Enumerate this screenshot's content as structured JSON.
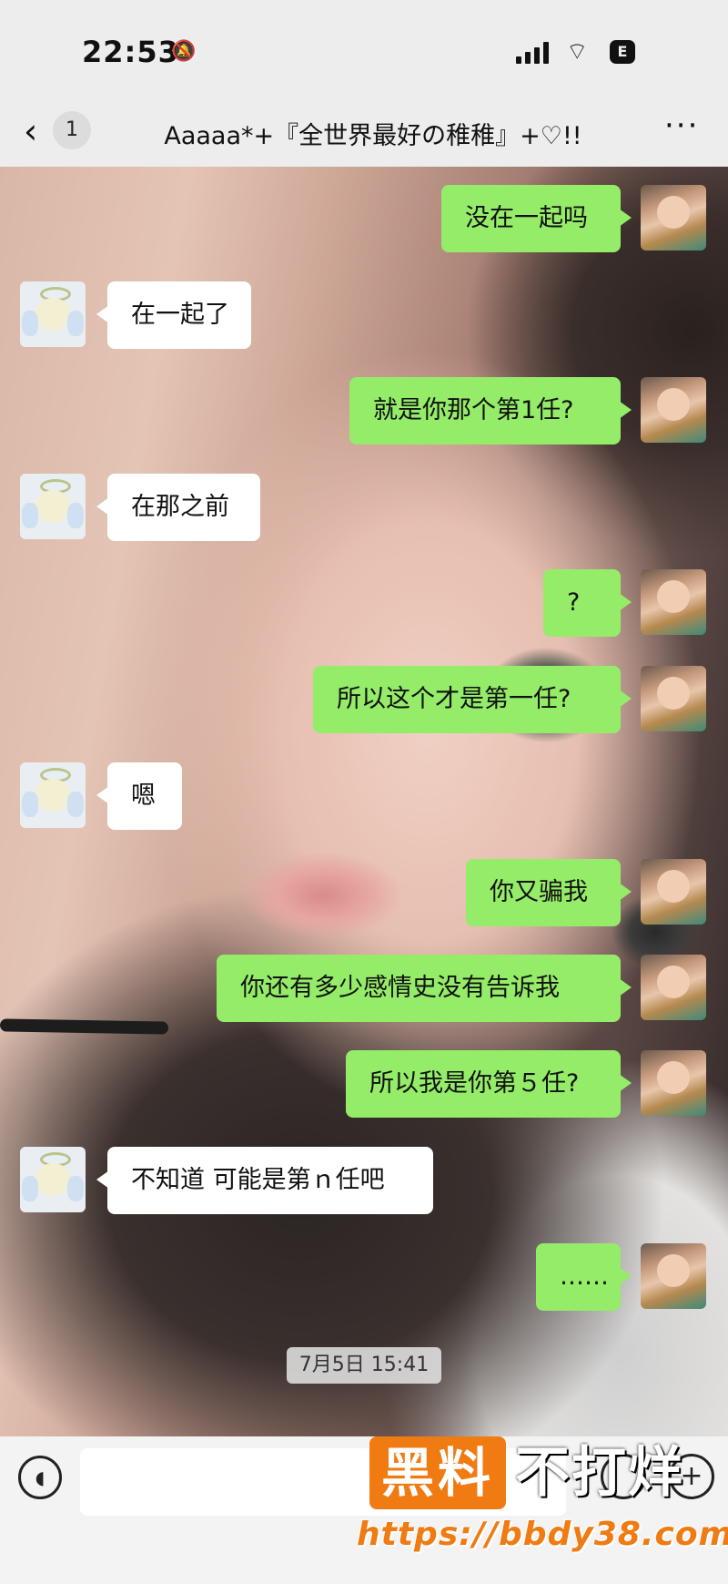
{
  "status_bar": {
    "time": "22:53",
    "battery_label": "E"
  },
  "nav": {
    "unread_count": "1",
    "chat_title": "Aaaaa*+『全世界最好の稚稚』+♡!!",
    "icons": [
      "chevron-left-icon",
      "more-icon"
    ]
  },
  "messages": [
    {
      "side": "right",
      "text": "没在一起吗"
    },
    {
      "side": "left",
      "text": "在一起了"
    },
    {
      "side": "right",
      "text": "就是你那个第1任?"
    },
    {
      "side": "left",
      "text": "在那之前"
    },
    {
      "side": "right",
      "text": "?"
    },
    {
      "side": "right",
      "text": "所以这个才是第一任?"
    },
    {
      "side": "left",
      "text": "嗯"
    },
    {
      "side": "right",
      "text": "你又骗我"
    },
    {
      "side": "right",
      "text": "你还有多少感情史没有告诉我"
    },
    {
      "side": "right",
      "text": "所以我是你第５任?"
    },
    {
      "side": "left",
      "text": "不知道 可能是第ｎ任吧"
    },
    {
      "side": "right",
      "text": "……"
    }
  ],
  "timestamp": "7月5日 15:41",
  "input_bar": {
    "placeholder": "",
    "icons": [
      "voice-icon",
      "emoji-icon",
      "plus-icon"
    ]
  },
  "watermark": {
    "box_text": "黑料",
    "text": "不打烊",
    "url": "https://bbdy38.com",
    "accent_color": "#f07b12"
  },
  "colors": {
    "right_bubble": "#95ec69",
    "left_bubble": "#ffffff",
    "bar_background": "#ededed"
  }
}
